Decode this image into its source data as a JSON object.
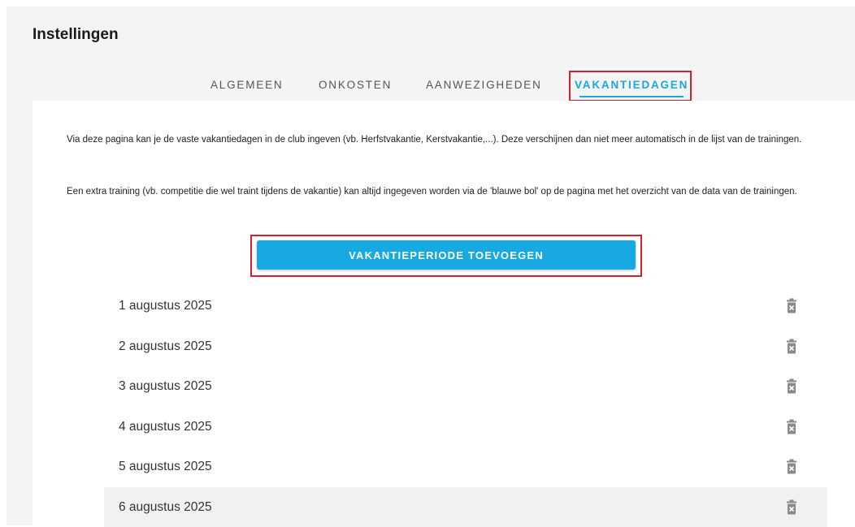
{
  "page": {
    "title": "Instellingen"
  },
  "tabs": [
    {
      "label": "ALGEMEEN",
      "active": false
    },
    {
      "label": "ONKOSTEN",
      "active": false
    },
    {
      "label": "AANWEZIGHEDEN",
      "active": false
    },
    {
      "label": "VAKANTIEDAGEN",
      "active": true
    }
  ],
  "content": {
    "paragraph1": "Via deze pagina kan je de vaste vakantiedagen in de club ingeven (vb. Herfstvakantie, Kerstvakantie,...). Deze verschijnen dan niet meer automatisch in de lijst van de trainingen.",
    "paragraph2": "Een extra training (vb. competitie die wel traint tijdens de vakantie) kan altijd ingegeven worden via de 'blauwe bol' op de pagina met het overzicht van de data van de trainingen.",
    "add_button_label": "VAKANTIEPERIODE TOEVOEGEN"
  },
  "vacation_days": [
    {
      "label": "1 augustus 2025"
    },
    {
      "label": "2 augustus 2025"
    },
    {
      "label": "3 augustus 2025"
    },
    {
      "label": "4 augustus 2025"
    },
    {
      "label": "5 augustus 2025"
    },
    {
      "label": "6 augustus 2025"
    }
  ],
  "colors": {
    "accent": "#19a9e2",
    "highlight": "#d3202a",
    "icon": "#8a8a8a"
  },
  "icons": {
    "delete": "trash-icon"
  }
}
